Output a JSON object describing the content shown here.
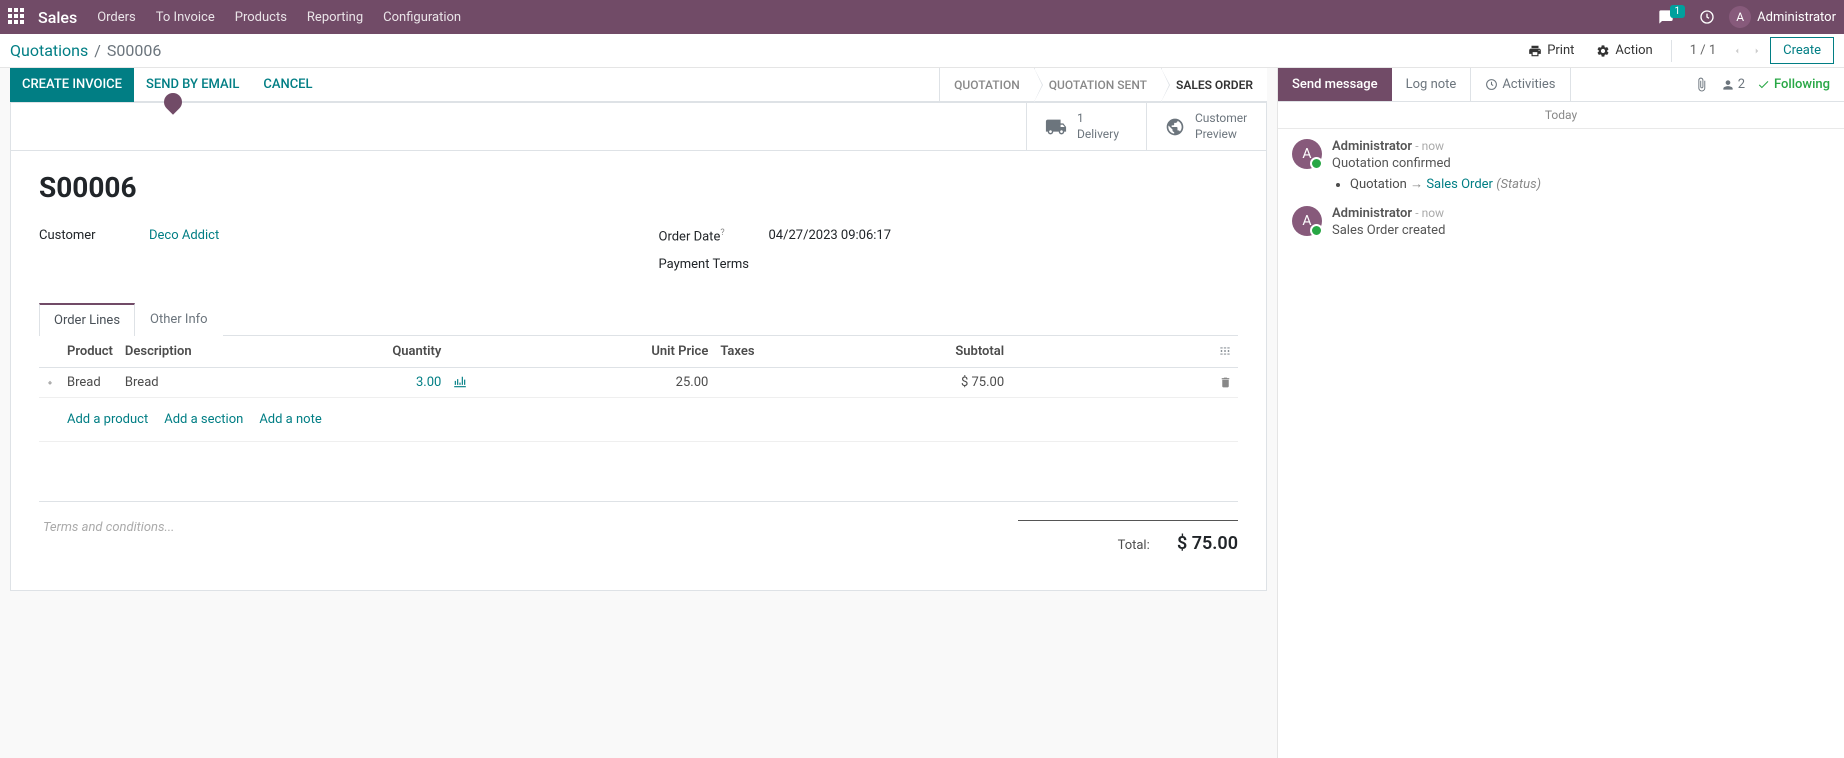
{
  "topnav": {
    "brand": "Sales",
    "menu": [
      "Orders",
      "To Invoice",
      "Products",
      "Reporting",
      "Configuration"
    ],
    "msg_badge": "1",
    "user_initial": "A",
    "user_name": "Administrator"
  },
  "breadcrumb": {
    "parent": "Quotations",
    "current": "S00006"
  },
  "subbar": {
    "print": "Print",
    "action": "Action",
    "pager": "1 / 1",
    "create": "Create"
  },
  "actions": {
    "create_invoice": "CREATE INVOICE",
    "send_email": "SEND BY EMAIL",
    "cancel": "CANCEL"
  },
  "status_steps": [
    "QUOTATION",
    "QUOTATION SENT",
    "SALES ORDER"
  ],
  "stat_buttons": {
    "delivery_count": "1",
    "delivery_label": "Delivery",
    "customer_preview_l1": "Customer",
    "customer_preview_l2": "Preview"
  },
  "order": {
    "title": "S00006",
    "customer_label": "Customer",
    "customer_value": "Deco Addict",
    "order_date_label": "Order Date",
    "order_date_value": "04/27/2023 09:06:17",
    "payment_terms_label": "Payment Terms"
  },
  "tabs": {
    "order_lines": "Order Lines",
    "other_info": "Other Info"
  },
  "table": {
    "headers": {
      "product": "Product",
      "description": "Description",
      "quantity": "Quantity",
      "unit_price": "Unit Price",
      "taxes": "Taxes",
      "subtotal": "Subtotal"
    },
    "rows": [
      {
        "product": "Bread",
        "description": "Bread",
        "quantity": "3.00",
        "unit_price": "25.00",
        "taxes": "",
        "subtotal": "$ 75.00"
      }
    ],
    "add_product": "Add a product",
    "add_section": "Add a section",
    "add_note": "Add a note"
  },
  "footer": {
    "terms_placeholder": "Terms and conditions...",
    "total_label": "Total:",
    "total_value": "$ 75.00"
  },
  "chat": {
    "send_message": "Send message",
    "log_note": "Log note",
    "activities": "Activities",
    "followers_count": "2",
    "following": "Following",
    "today": "Today",
    "messages": [
      {
        "author": "Administrator",
        "time": "now",
        "text": "Quotation confirmed",
        "bullet_from": "Quotation",
        "bullet_to": "Sales Order",
        "bullet_status": "(Status)"
      },
      {
        "author": "Administrator",
        "time": "now",
        "text": "Sales Order created"
      }
    ]
  }
}
